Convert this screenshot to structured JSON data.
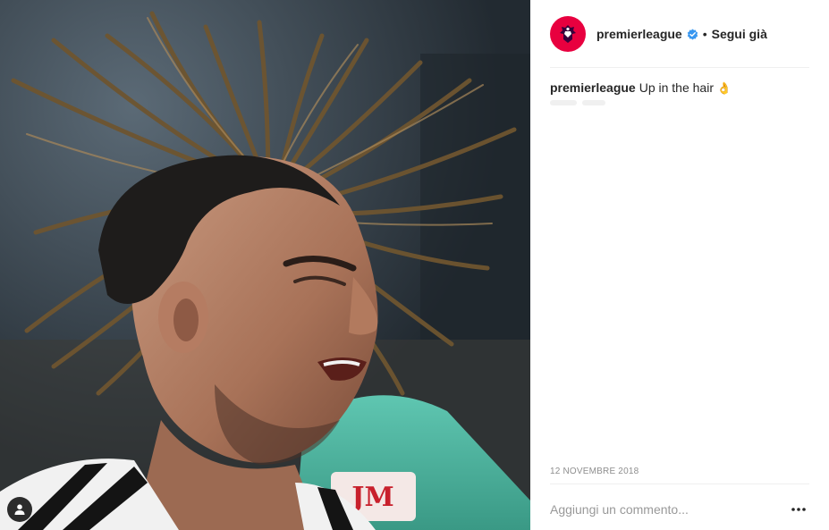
{
  "post": {
    "image_description": "",
    "account": {
      "username": "premierleague",
      "verified": true,
      "separator": "•",
      "follow_state": "Segui già",
      "avatar_color": "#e8003f"
    },
    "caption": {
      "username": "premierleague",
      "text": "Up in the hair",
      "emoji": "👌"
    },
    "date": "12 NOVEMBRE 2018",
    "comment": {
      "placeholder": "Aggiungi un commento...",
      "value": ""
    }
  },
  "icons": {
    "tag": "person-icon",
    "verified": "verified-badge-icon",
    "more": "more-options-icon",
    "avatar": "lion-logo-icon"
  },
  "colors": {
    "verified_blue": "#3897f0",
    "text_primary": "#262626",
    "text_secondary": "#8e8e8e",
    "divider": "#efefef"
  }
}
